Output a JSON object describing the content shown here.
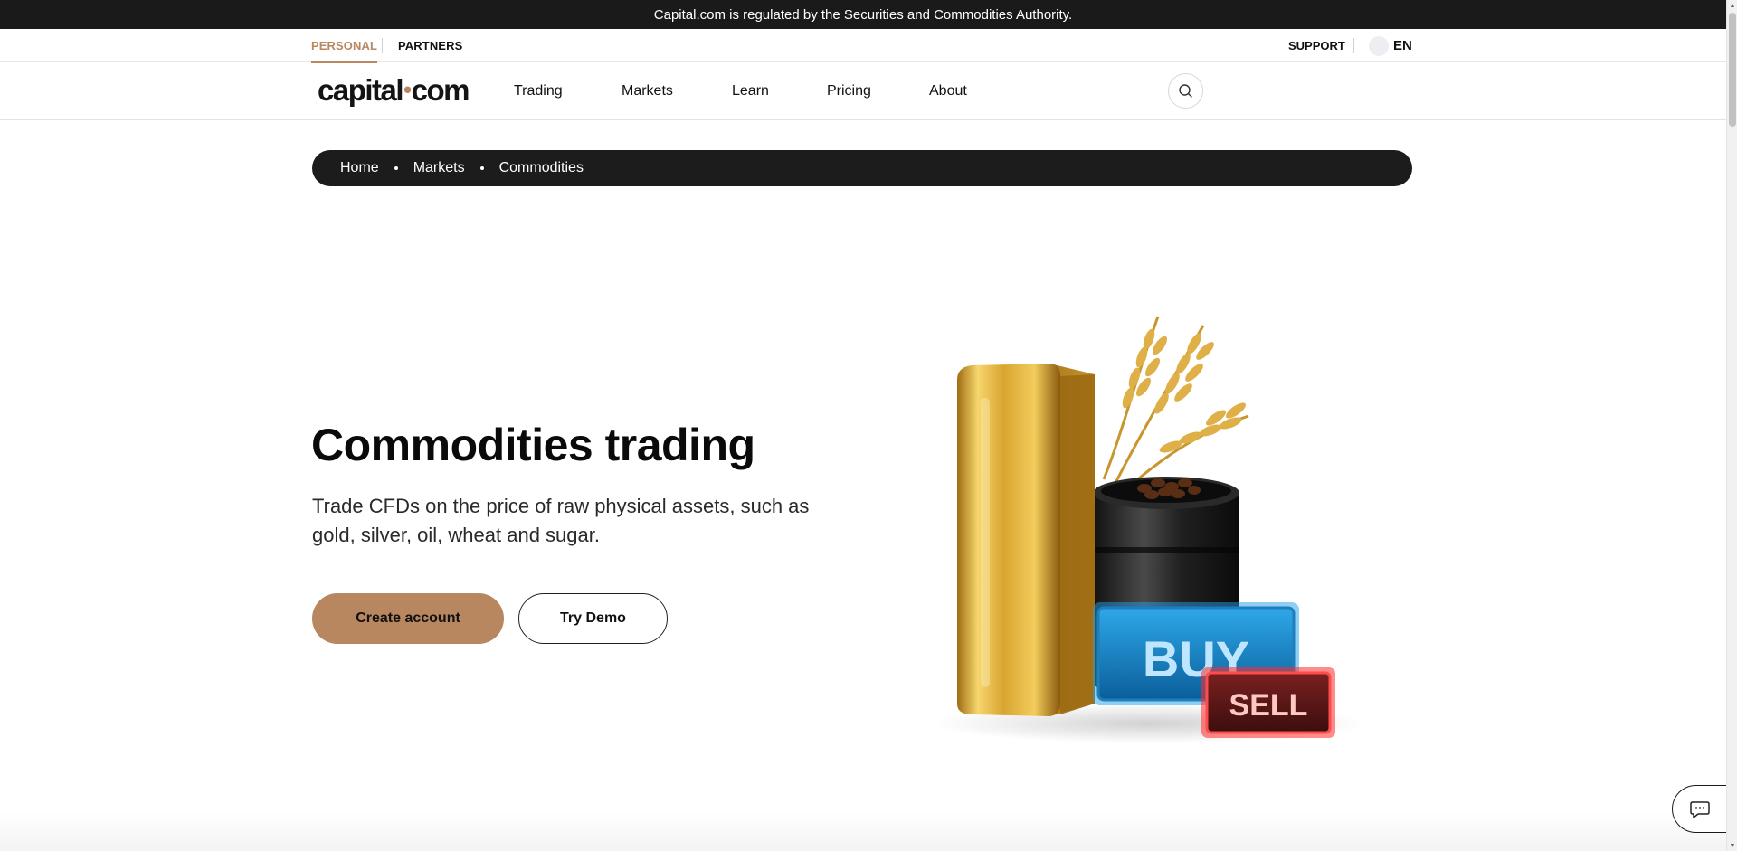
{
  "regulation_banner": "Capital.com is regulated by the Securities and Commodities Authority.",
  "top_bar": {
    "personal_label": "PERSONAL",
    "partners_label": "PARTNERS",
    "support_label": "SUPPORT",
    "language_label": "EN"
  },
  "header": {
    "logo_left": "capital",
    "logo_dot": "•",
    "logo_right": "com",
    "nav": [
      "Trading",
      "Markets",
      "Learn",
      "Pricing",
      "About"
    ],
    "search_icon": "search-icon"
  },
  "breadcrumb": [
    "Home",
    "Markets",
    "Commodities"
  ],
  "hero": {
    "title": "Commodities trading",
    "description": "Trade CFDs on the price of raw physical assets, such as gold, silver, oil, wheat and sugar.",
    "create_account_label": "Create account",
    "try_demo_label": "Try Demo",
    "illustration": {
      "buy_label": "BUY",
      "sell_label": "SELL"
    }
  },
  "chat_icon": "chat-icon",
  "colors": {
    "accent": "#b8865f",
    "dark": "#1a1a1a"
  }
}
